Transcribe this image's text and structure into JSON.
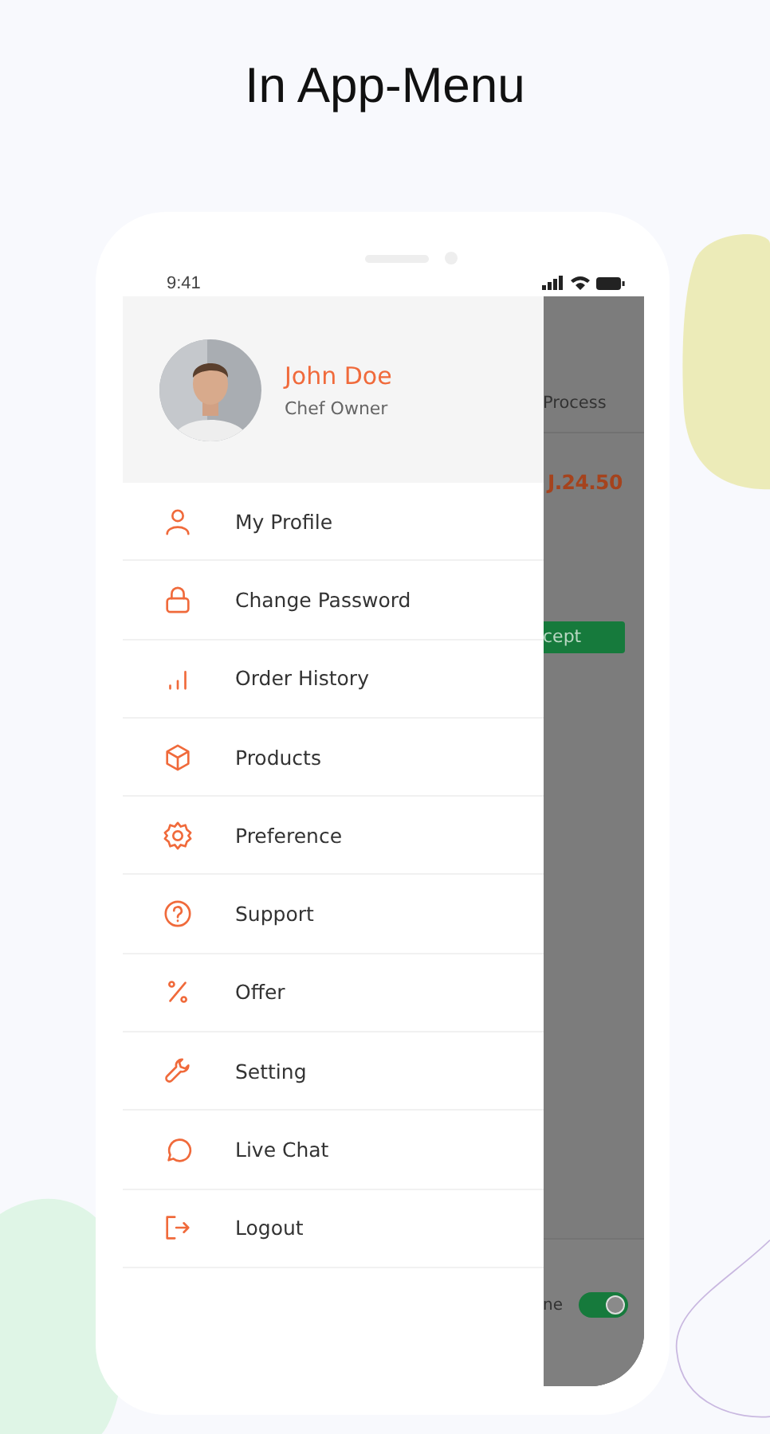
{
  "page_title": "In App-Menu",
  "status_bar": {
    "time": "9:41"
  },
  "profile": {
    "name": "John Doe",
    "role": "Chef Owner"
  },
  "menu": [
    {
      "label": "My Profile"
    },
    {
      "label": "Change Password"
    },
    {
      "label": "Order History"
    },
    {
      "label": "Products"
    },
    {
      "label": "Preference"
    },
    {
      "label": "Support"
    },
    {
      "label": "Offer"
    },
    {
      "label": "Setting"
    },
    {
      "label": "Live Chat"
    },
    {
      "label": "Logout"
    }
  ],
  "background_screen": {
    "tab_label": "Process",
    "price": "J.24.50",
    "button": "cept",
    "toggle_label": "ne",
    "toggle_on": true
  }
}
